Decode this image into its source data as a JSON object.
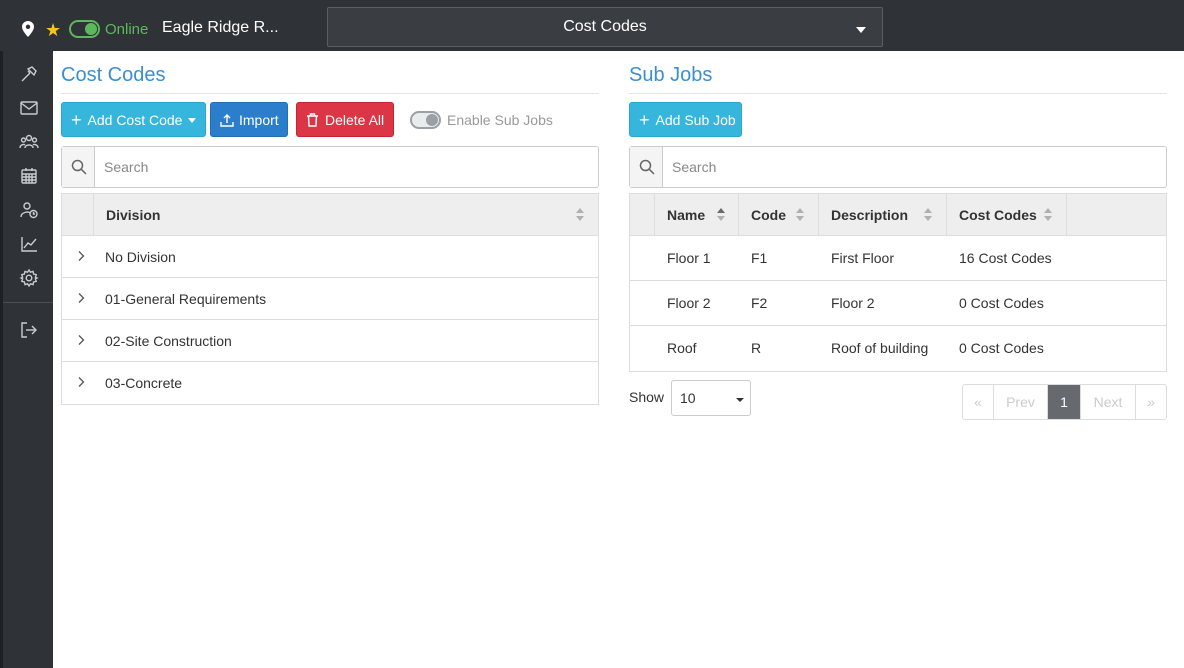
{
  "topbar": {
    "status": "Online",
    "project_name": "Eagle Ridge R...",
    "page_selector": "Cost Codes"
  },
  "sidebar": {
    "items": [
      "hammer-icon",
      "mail-icon",
      "users-icon",
      "calendar-icon",
      "user-clock-icon",
      "chart-icon",
      "gear-icon",
      "logout-icon"
    ]
  },
  "cost_codes": {
    "title": "Cost Codes",
    "add_button": "Add Cost Code",
    "import_button": "Import",
    "delete_all_button": "Delete All",
    "enable_sub_jobs": "Enable Sub Jobs",
    "search_placeholder": "Search",
    "column_header": "Division",
    "divisions": [
      "No Division",
      "01-General Requirements",
      "02-Site Construction",
      "03-Concrete"
    ]
  },
  "sub_jobs": {
    "title": "Sub Jobs",
    "add_button": "Add Sub Job",
    "search_placeholder": "Search",
    "columns": [
      "Name",
      "Code",
      "Description",
      "Cost Codes"
    ],
    "rows": [
      {
        "name": "Floor 1",
        "code": "F1",
        "description": "First Floor",
        "cost_codes": "16 Cost Codes"
      },
      {
        "name": "Floor 2",
        "code": "F2",
        "description": "Floor 2",
        "cost_codes": "0 Cost Codes"
      },
      {
        "name": "Roof",
        "code": "R",
        "description": "Roof of building",
        "cost_codes": "0 Cost Codes"
      }
    ],
    "show_label": "Show",
    "page_size": "10",
    "pagination": {
      "first": "«",
      "prev": "Prev",
      "current": "1",
      "next": "Next",
      "last": "»"
    }
  },
  "colors": {
    "accent": "#3b8fd0",
    "online": "#5cb85c",
    "info": "#36b6dd",
    "primary": "#2a7ecb",
    "danger": "#dc3545",
    "bar": "#2f3337"
  }
}
